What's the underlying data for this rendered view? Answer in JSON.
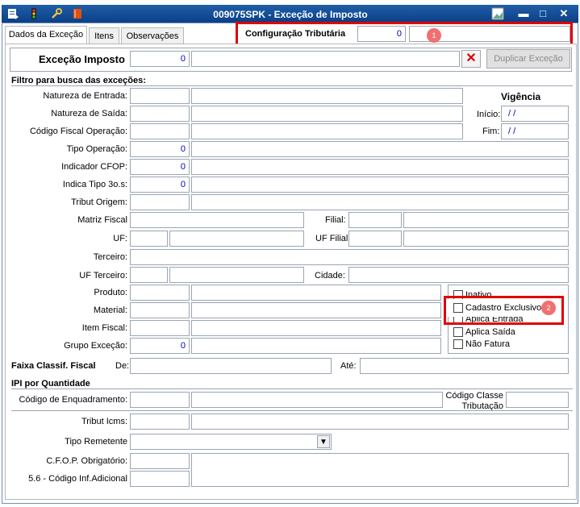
{
  "window": {
    "title": "009075SPK - Exceção de Imposto"
  },
  "toolbar_icons": [
    "document-icon",
    "traffic-light-icon",
    "wrench-icon",
    "book-icon"
  ],
  "window_controls": {
    "minimize": "▬",
    "maximize": "□",
    "close": "✕"
  },
  "tabs": [
    {
      "label": "Dados da Exceção"
    },
    {
      "label": "Itens"
    },
    {
      "label": "Observações"
    }
  ],
  "config_tributaria": {
    "label": "Configuração Tributária",
    "value": "0",
    "badge": "1"
  },
  "excecao": {
    "label": "Exceção Imposto",
    "value": "0",
    "duplicar_label": "Duplicar Exceção"
  },
  "filtro": {
    "heading": "Filtro para busca das exceções:",
    "natureza_entrada": "Natureza de Entrada:",
    "natureza_saida": "Natureza de Saída:",
    "codigo_fiscal": "Código Fiscal Operação:",
    "tipo_operacao": {
      "label": "Tipo Operação:",
      "value": "0"
    },
    "indicador_cfop": {
      "label": "Indicador CFOP:",
      "value": "0"
    },
    "indica_tipo": {
      "label": "Indica Tipo 3o.s:",
      "value": "0"
    },
    "tribut_origem": "Tribut Origem:",
    "matriz_fiscal": "Matriz Fiscal",
    "filial": "Filial:",
    "uf": "UF:",
    "uf_filial": "UF Filial",
    "terceiro": "Terceiro:",
    "uf_terceiro": "UF Terceiro:",
    "cidade": "Cidade:",
    "produto": "Produto:",
    "material": "Material:",
    "item_fiscal": "Item Fiscal:",
    "grupo_excecao": {
      "label": "Grupo Exceção:",
      "value": "0"
    }
  },
  "vigencia": {
    "title": "Vigência",
    "inicio_label": "Início:",
    "inicio_value": "/ /",
    "fim_label": "Fim:",
    "fim_value": "/ /"
  },
  "checkboxes": {
    "inativo": "Inativo",
    "cadastro_exclusivo": "Cadastro Exclusivo",
    "aplica_entrada": "Aplica Entrada",
    "aplica_saida": "Aplica Saída",
    "nao_fatura": "Não Fatura",
    "badge": "2"
  },
  "faixa": {
    "label": "Faixa Classif. Fiscal",
    "de": "De:",
    "ate": "Até:"
  },
  "ipi": {
    "heading": "IPI por Quantidade",
    "codigo_enquadramento": "Código de Enquadramento:",
    "codigo_classe_line1": "Código Classe",
    "codigo_classe_line2": "Tributação",
    "tribut_icms": "Tribut Icms:",
    "tipo_remetente": "Tipo Remetente",
    "cfop_obrigatorio": "C.F.O.P. Obrigatório:",
    "codigo_inf_adicional": "5.6 - Código Inf.Adicional"
  },
  "colors": {
    "titlebar": "#0b3f86",
    "highlight": "#e00000",
    "number": "#0000c0"
  }
}
